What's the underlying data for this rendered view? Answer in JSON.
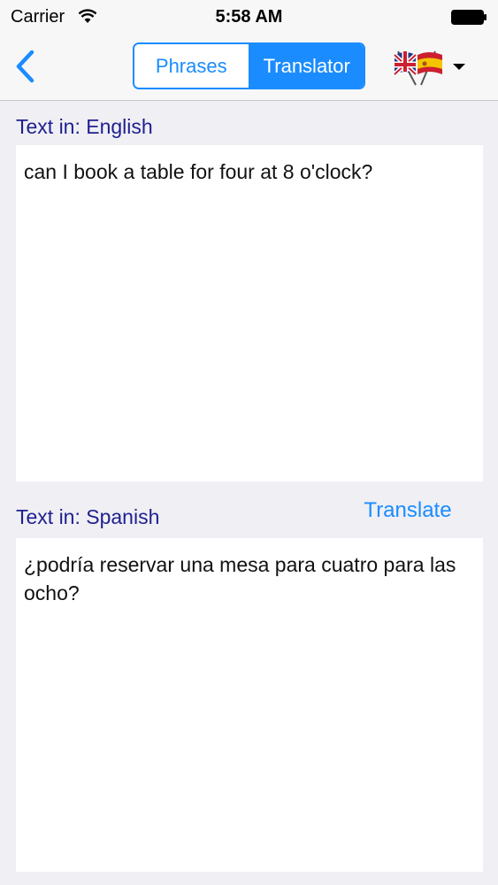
{
  "status_bar": {
    "carrier": "Carrier",
    "time": "5:58 AM"
  },
  "nav": {
    "back_icon": "chevron-left-icon",
    "segments": [
      "Phrases",
      "Translator"
    ],
    "selected_segment": "Translator",
    "language_picker_icon": "uk-spain-flags-icon"
  },
  "source": {
    "label": "Text in: English",
    "text": "can I book a table for four at 8 o'clock?"
  },
  "target": {
    "label": "Text in: Spanish",
    "text": "¿podría reservar una mesa para cuatro para las ocho?"
  },
  "translate_label": "Translate",
  "colors": {
    "accent": "#1a8cff",
    "label": "#1f1f8f",
    "background": "#efeff4"
  }
}
